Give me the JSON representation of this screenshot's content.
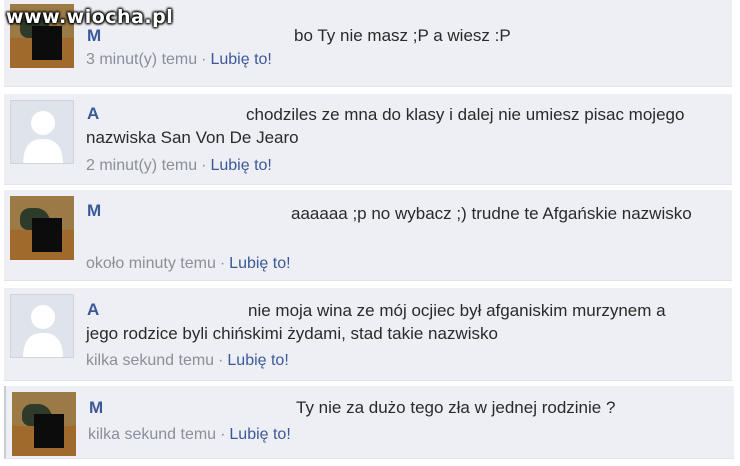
{
  "watermark": "www.wiocha.pl",
  "comments": [
    {
      "author": "M",
      "avatar": "photo-avatar-censored",
      "text": "bo Ty nie masz ;P a wiesz :P",
      "time": "3 minut(y) temu",
      "separator": "·",
      "like": "Lubię to!"
    },
    {
      "author": "A",
      "avatar": "default-silhouette-avatar",
      "text": "chodziles ze mna do klasy i dalej nie umiesz pisac mojego nazwiska San Von De Jearo",
      "time": "2 minut(y) temu",
      "separator": "·",
      "like": "Lubię to!"
    },
    {
      "author": "M",
      "avatar": "photo-avatar-censored",
      "text": "aaaaaa ;p no wybacz ;) trudne te Afgańskie nazwisko",
      "time": "około minuty temu",
      "separator": "·",
      "like": "Lubię to!"
    },
    {
      "author": "A",
      "avatar": "default-silhouette-avatar",
      "text": "nie moja wina ze mój ocjiec był afganiskim murzynem a jego rodzice byli chińskimi żydami, stad takie nazwisko",
      "time": "kilka sekund temu",
      "separator": "·",
      "like": "Lubię to!"
    },
    {
      "author": "M",
      "avatar": "photo-avatar-censored",
      "text": "Ty nie za dużo tego zła w jednej rodzinie ?",
      "time": "kilka sekund temu",
      "separator": "·",
      "like": "Lubię to!"
    }
  ],
  "colors": {
    "comment_background": "#edeff4",
    "author_link": "#3b5998",
    "like_link": "#3b5998",
    "meta_text": "#8a8f99"
  }
}
